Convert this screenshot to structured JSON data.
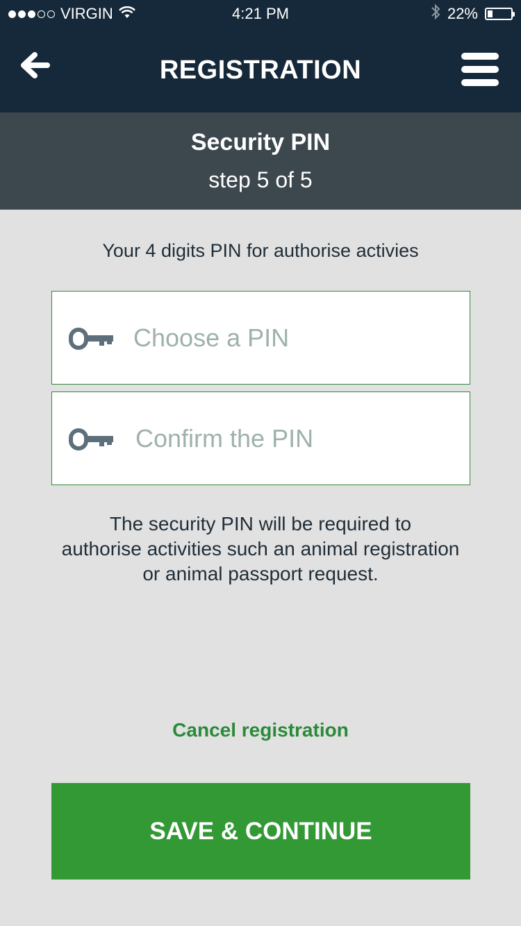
{
  "status_bar": {
    "carrier": "VIRGIN",
    "signal_strength": 3,
    "signal_max": 5,
    "time": "4:21 PM",
    "battery_percent": "22%",
    "battery_level": 0.22
  },
  "header": {
    "title": "REGISTRATION",
    "back_icon": "arrow-left-icon",
    "menu_icon": "hamburger-menu-icon"
  },
  "step": {
    "title": "Security PIN",
    "subtitle": "step 5 of 5"
  },
  "form": {
    "intro": "Your 4 digits PIN for authorise activies",
    "pin": {
      "placeholder": "Choose a PIN",
      "value": "",
      "icon": "key-icon"
    },
    "confirm_pin": {
      "placeholder": "Confirm the PIN",
      "value": "",
      "icon": "key-icon"
    },
    "info_lines": [
      "The security PIN will be required to",
      "authorise activities such an animal registration",
      "or animal passport request."
    ]
  },
  "actions": {
    "cancel_label": "Cancel registration",
    "save_label": "SAVE & CONTINUE"
  },
  "colors": {
    "header_bg": "#16293a",
    "step_bg": "#3d474e",
    "page_bg": "#e1e1e1",
    "accent_green": "#339934",
    "link_green": "#2a8a3a",
    "field_border": "#2f8a3a",
    "placeholder": "#9eb1ab"
  }
}
